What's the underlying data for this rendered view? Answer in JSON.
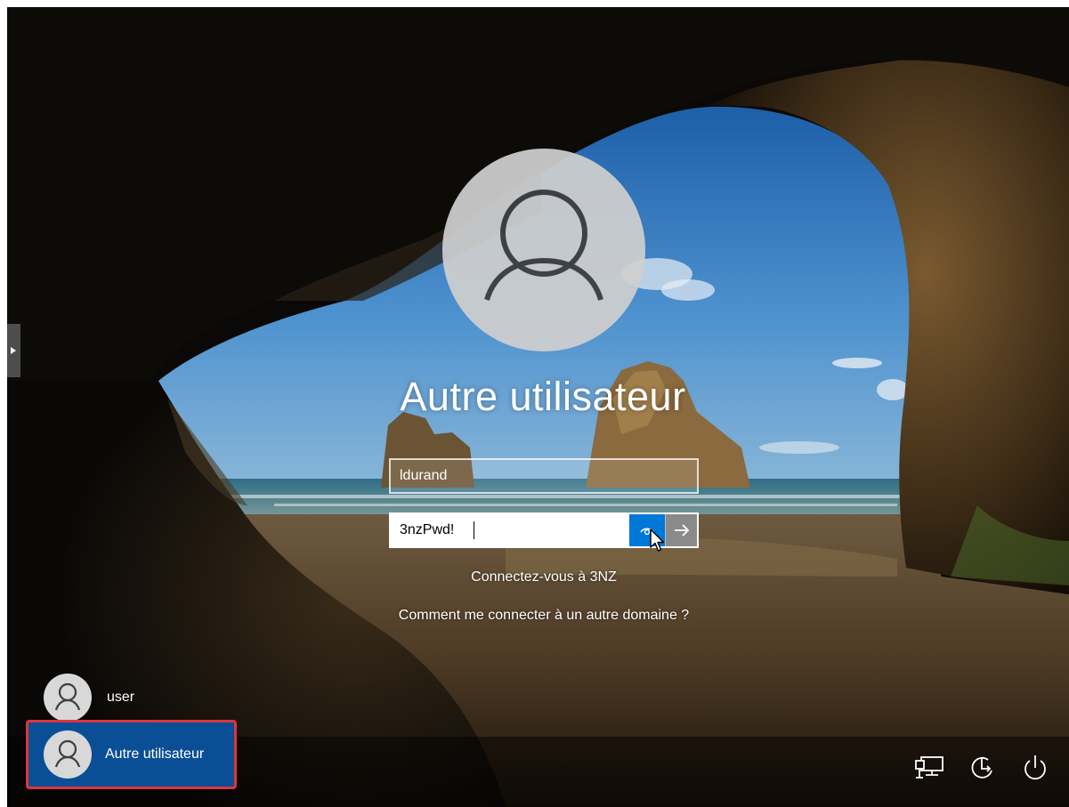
{
  "login": {
    "title": "Autre utilisateur",
    "username_value": "ldurand",
    "password_value": "3nzPwd!",
    "connect_text": "Connectez-vous à 3NZ",
    "other_domain_text": "Comment me connecter à un autre domaine ?"
  },
  "users": [
    {
      "label": "user",
      "selected": false
    },
    {
      "label": "Autre utilisateur",
      "selected": true
    }
  ],
  "icons": {
    "avatar": "person-icon",
    "reveal": "eye-icon",
    "submit": "arrow-right-icon",
    "side_tab": "triangle-right-icon",
    "network": "network-icon",
    "ease_of_access": "ease-of-access-icon",
    "power": "power-icon"
  },
  "colors": {
    "accent": "#0078d7",
    "selected_tile": "#0a4f96",
    "highlight_border": "#e0343b"
  }
}
